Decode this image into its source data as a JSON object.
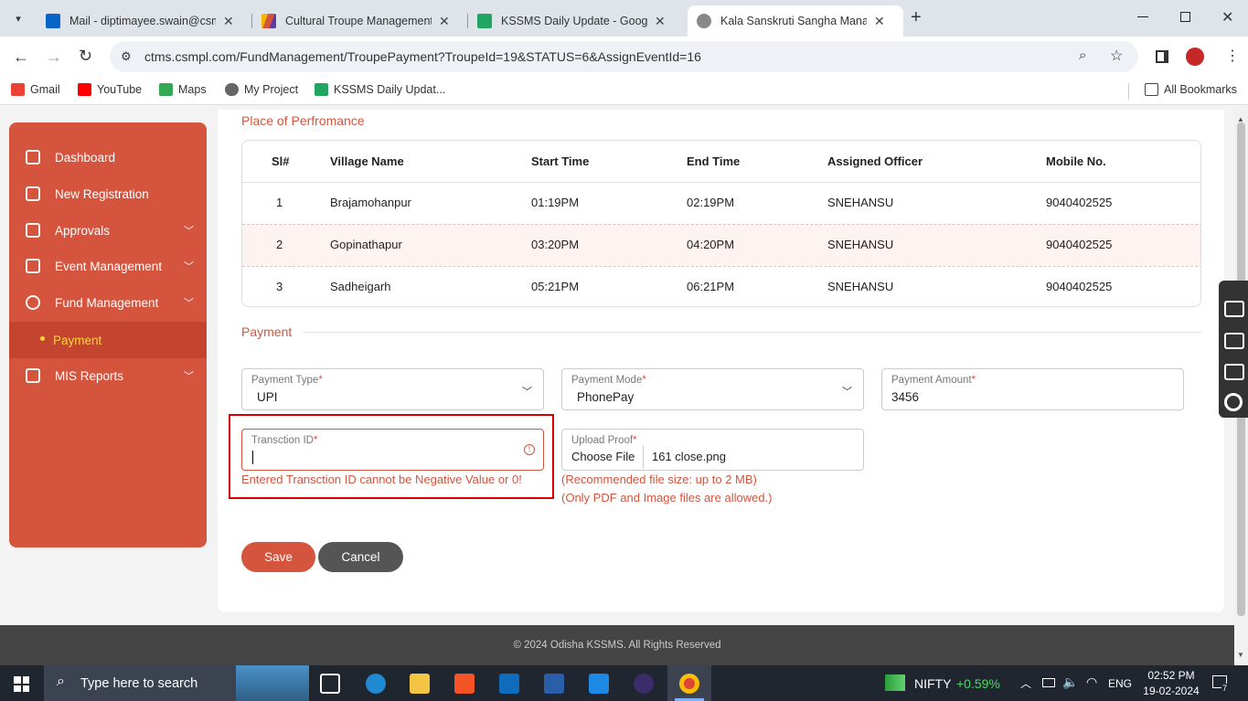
{
  "browser": {
    "tabs": [
      {
        "title": "Mail - diptimayee.swain@csm.t",
        "active": false
      },
      {
        "title": "Cultural Troupe Management S",
        "active": false
      },
      {
        "title": "KSSMS Daily Update - Google S",
        "active": false
      },
      {
        "title": "Kala Sanskruti Sangha Manager",
        "active": true
      }
    ],
    "url": "ctms.csmpl.com/FundManagement/TroupePayment?TroupeId=19&STATUS=6&AssignEventId=16",
    "bookmarks": [
      "Gmail",
      "YouTube",
      "Maps",
      "My Project",
      "KSSMS Daily Updat..."
    ],
    "all_bookmarks": "All Bookmarks"
  },
  "sidebar": {
    "items": [
      {
        "label": "Dashboard",
        "icon": "grid-icon",
        "expandable": false
      },
      {
        "label": "New Registration",
        "icon": "edit-icon",
        "expandable": true
      },
      {
        "label": "Approvals",
        "icon": "approval-icon",
        "expandable": true
      },
      {
        "label": "Event Management",
        "icon": "calendar-icon",
        "expandable": true
      },
      {
        "label": "Fund Management",
        "icon": "money-bag-icon",
        "expandable": true
      },
      {
        "label": "Payment",
        "icon": "bullet-icon",
        "active": true
      },
      {
        "label": "MIS Reports",
        "icon": "report-icon",
        "expandable": true
      }
    ]
  },
  "performance": {
    "title": "Place of Perfromance",
    "headers": [
      "Sl#",
      "Village Name",
      "Start Time",
      "End Time",
      "Assigned Officer",
      "Mobile No."
    ],
    "rows": [
      [
        "1",
        "Brajamohanpur",
        "01:19PM",
        "02:19PM",
        "SNEHANSU",
        "9040402525"
      ],
      [
        "2",
        "Gopinathapur",
        "03:20PM",
        "04:20PM",
        "SNEHANSU",
        "9040402525"
      ],
      [
        "3",
        "Sadheigarh",
        "05:21PM",
        "06:21PM",
        "SNEHANSU",
        "9040402525"
      ]
    ]
  },
  "payment": {
    "title": "Payment",
    "payment_type": {
      "label": "Payment Type",
      "value": "UPI"
    },
    "payment_mode": {
      "label": "Payment Mode",
      "value": "PhonePay"
    },
    "payment_amount": {
      "label": "Payment Amount",
      "value": "3456"
    },
    "transaction_id": {
      "label": "Transction ID",
      "value": "",
      "error": "Entered Transction ID cannot be Negative Value or 0!"
    },
    "upload_proof": {
      "label": "Upload Proof",
      "button": "Choose File",
      "filename": "161 close.png"
    },
    "notes": [
      "(Recommended file size: up to 2 MB)",
      "(Only PDF and Image files are allowed.)"
    ],
    "save_label": "Save",
    "cancel_label": "Cancel"
  },
  "footer": "© 2024 Odisha KSSMS. All Rights Reserved",
  "taskbar": {
    "search_placeholder": "Type here to search",
    "nifty_label": "NIFTY",
    "nifty_change": "+0.59%",
    "language": "ENG",
    "time": "02:52 PM",
    "date": "19-02-2024",
    "notification_count": "7"
  },
  "colors": {
    "accent": "#d5543e",
    "active_sub": "#ffd33d",
    "error": "#d80000"
  }
}
